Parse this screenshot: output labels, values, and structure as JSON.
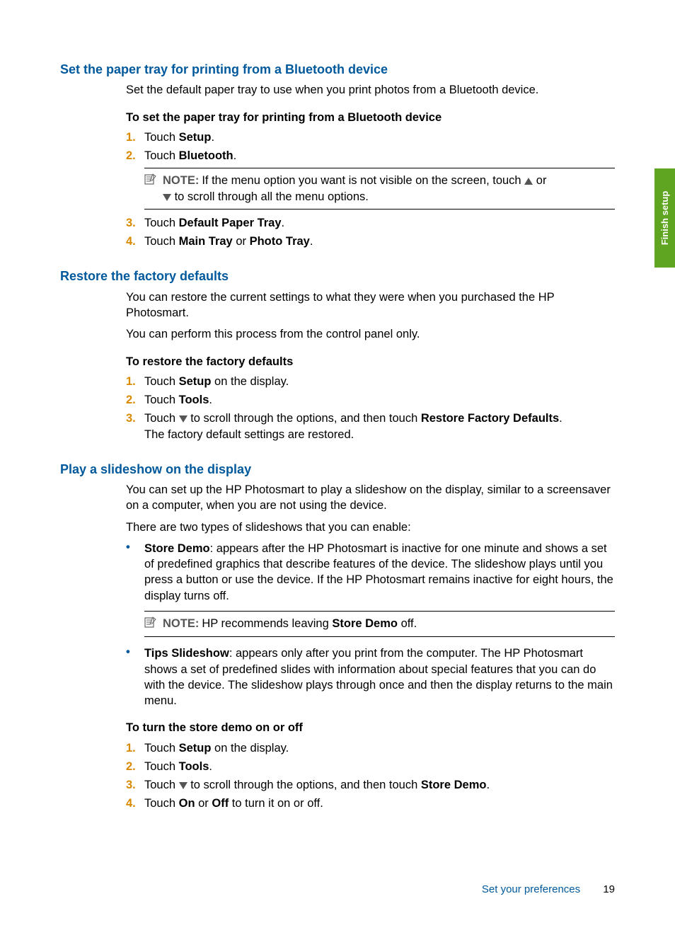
{
  "sideTab": "Finish setup",
  "sections": [
    {
      "heading": "Set the paper tray for printing from a Bluetooth device",
      "intro": [
        "Set the default paper tray to use when you print photos from a Bluetooth device."
      ],
      "subhead": "To set the paper tray for printing from a Bluetooth device",
      "steps": [
        {
          "num": "1.",
          "pre": "Touch ",
          "bold": "Setup",
          "post": "."
        },
        {
          "num": "2.",
          "pre": "Touch ",
          "bold": "Bluetooth",
          "post": ".",
          "note": {
            "label": "NOTE:",
            "line1a": "If the menu option you want is not visible on the screen, touch ",
            "line1b": " or",
            "line2a": "",
            "line2b": " to scroll through all the menu options."
          }
        },
        {
          "num": "3.",
          "pre": "Touch ",
          "bold": "Default Paper Tray",
          "post": "."
        },
        {
          "num": "4.",
          "pre": "Touch ",
          "bold": "Main Tray",
          "mid": " or ",
          "bold2": "Photo Tray",
          "post": "."
        }
      ]
    },
    {
      "heading": "Restore the factory defaults",
      "intro": [
        "You can restore the current settings to what they were when you purchased the HP Photosmart.",
        "You can perform this process from the control panel only."
      ],
      "subhead": "To restore the factory defaults",
      "steps": [
        {
          "num": "1.",
          "pre": "Touch ",
          "bold": "Setup",
          "post": " on the display."
        },
        {
          "num": "2.",
          "pre": "Touch ",
          "bold": "Tools",
          "post": "."
        },
        {
          "num": "3.",
          "pre": "Touch ",
          "tri": "down",
          "mid": " to scroll through the options, and then touch ",
          "bold": "Restore Factory Defaults",
          "post": ".",
          "tail": "The factory default settings are restored."
        }
      ]
    },
    {
      "heading": "Play a slideshow on the display",
      "intro": [
        "You can set up the HP Photosmart to play a slideshow on the display, similar to a screensaver on a computer, when you are not using the device.",
        "There are two types of slideshows that you can enable:"
      ],
      "bullets": [
        {
          "bold": "Store Demo",
          "text": ": appears after the HP Photosmart is inactive for one minute and shows a set of predefined graphics that describe features of the device. The slideshow plays until you press a button or use the device. If the HP Photosmart remains inactive for eight hours, the display turns off.",
          "note": {
            "label": "NOTE:",
            "pre": "HP recommends leaving ",
            "bold": "Store Demo",
            "post": " off."
          }
        },
        {
          "bold": "Tips Slideshow",
          "text": ": appears only after you print from the computer. The HP Photosmart shows a set of predefined slides with information about special features that you can do with the device. The slideshow plays through once and then the display returns to the main menu."
        }
      ],
      "subhead": "To turn the store demo on or off",
      "steps": [
        {
          "num": "1.",
          "pre": "Touch ",
          "bold": "Setup",
          "post": " on the display."
        },
        {
          "num": "2.",
          "pre": "Touch ",
          "bold": "Tools",
          "post": "."
        },
        {
          "num": "3.",
          "pre": "Touch ",
          "tri": "down",
          "mid": " to scroll through the options, and then touch ",
          "bold": "Store Demo",
          "post": "."
        },
        {
          "num": "4.",
          "pre": "Touch ",
          "bold": "On",
          "mid": " or ",
          "bold2": "Off",
          "post": " to turn it on or off."
        }
      ]
    }
  ],
  "footer": {
    "label": "Set your preferences",
    "page": "19"
  }
}
